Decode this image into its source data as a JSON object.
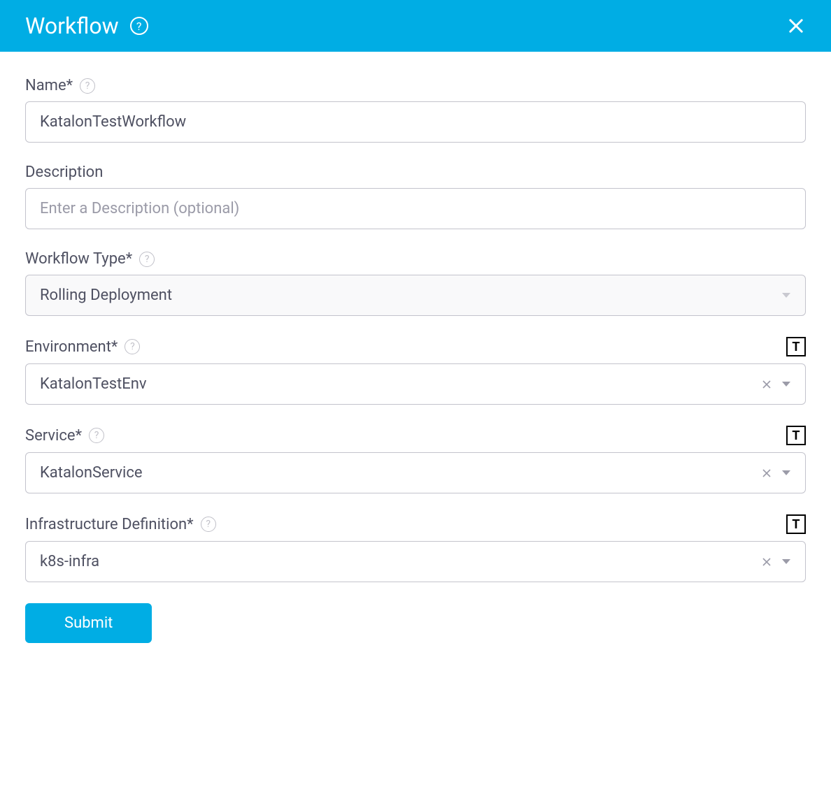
{
  "header": {
    "title": "Workflow"
  },
  "fields": {
    "name": {
      "label": "Name*",
      "value": "KatalonTestWorkflow"
    },
    "description": {
      "label": "Description",
      "placeholder": "Enter a Description (optional)",
      "value": ""
    },
    "workflowType": {
      "label": "Workflow Type*",
      "value": "Rolling Deployment"
    },
    "environment": {
      "label": "Environment*",
      "value": "KatalonTestEnv"
    },
    "service": {
      "label": "Service*",
      "value": "KatalonService"
    },
    "infrastructure": {
      "label": "Infrastructure Definition*",
      "value": "k8s-infra"
    }
  },
  "actions": {
    "submit": "Submit"
  },
  "icons": {
    "template": "T"
  }
}
